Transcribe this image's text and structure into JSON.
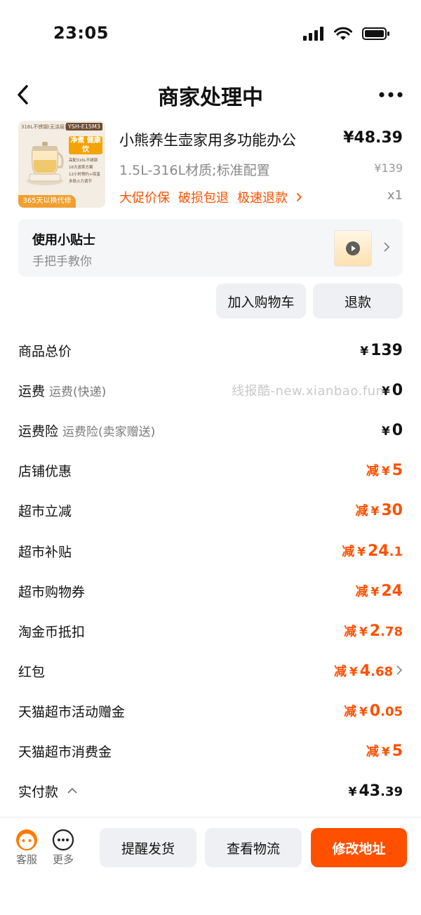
{
  "status_bar": {
    "time": "23:05"
  },
  "header": {
    "title": "商家处理中"
  },
  "product": {
    "name": "小熊养生壶家用多功能办公",
    "price": "¥48.39",
    "spec": "1.5L-316L材质;标准配置",
    "original_price": "¥139",
    "tags": [
      "大促价保",
      "破损包退",
      "极速退款"
    ],
    "quantity": "x1",
    "thumb": {
      "corner_label": "YSH-E15M3",
      "top_text": "316L不锈钢(无涂层)",
      "badge": "净煮 健康饮",
      "features": [
        "高配316L不锈钢",
        "16大滤茶方案",
        "12小时预约+保温",
        "多段火力调节"
      ],
      "bottom_text": "365天以换代修"
    }
  },
  "tips": {
    "title": "使用小贴士",
    "subtitle": "手把手教你"
  },
  "actions": {
    "add_cart": "加入购物车",
    "refund": "退款"
  },
  "price_rows": [
    {
      "label": "商品总价",
      "sub": "",
      "prefix": "",
      "int": "139",
      "dec": "",
      "orange": false
    },
    {
      "label": "运费",
      "sub": "运费(快递)",
      "prefix": "",
      "int": "0",
      "dec": "",
      "orange": false
    },
    {
      "label": "运费险",
      "sub": "运费险(卖家赠送)",
      "prefix": "",
      "int": "0",
      "dec": "",
      "orange": false
    },
    {
      "label": "店铺优惠",
      "sub": "",
      "prefix": "减",
      "int": "5",
      "dec": "",
      "orange": true
    },
    {
      "label": "超市立减",
      "sub": "",
      "prefix": "减",
      "int": "30",
      "dec": "",
      "orange": true
    },
    {
      "label": "超市补贴",
      "sub": "",
      "prefix": "减",
      "int": "24",
      "dec": ".1",
      "orange": true
    },
    {
      "label": "超市购物券",
      "sub": "",
      "prefix": "减",
      "int": "24",
      "dec": "",
      "orange": true
    },
    {
      "label": "淘金币抵扣",
      "sub": "",
      "prefix": "减",
      "int": "2",
      "dec": ".78",
      "orange": true
    },
    {
      "label": "红包",
      "sub": "",
      "prefix": "减",
      "int": "4",
      "dec": ".68",
      "orange": true,
      "chevron": true
    },
    {
      "label": "天猫超市活动赠金",
      "sub": "",
      "prefix": "减",
      "int": "0",
      "dec": ".05",
      "orange": true
    },
    {
      "label": "天猫超市消费金",
      "sub": "",
      "prefix": "减",
      "int": "5",
      "dec": "",
      "orange": true
    },
    {
      "label": "实付款",
      "sub": "",
      "prefix": "",
      "int": "43",
      "dec": ".39",
      "orange": false,
      "caret_up": true
    }
  ],
  "currency_symbol": "¥",
  "watermark": "线报酷-new.xianbao.fun",
  "bottom_bar": {
    "service": "客服",
    "more": "更多",
    "remind": "提醒发货",
    "logistics": "查看物流",
    "change_address": "修改地址"
  },
  "colors": {
    "accent": "#ff5000",
    "gray_button": "#eef0f3",
    "muted_text": "#8a8a8a"
  }
}
